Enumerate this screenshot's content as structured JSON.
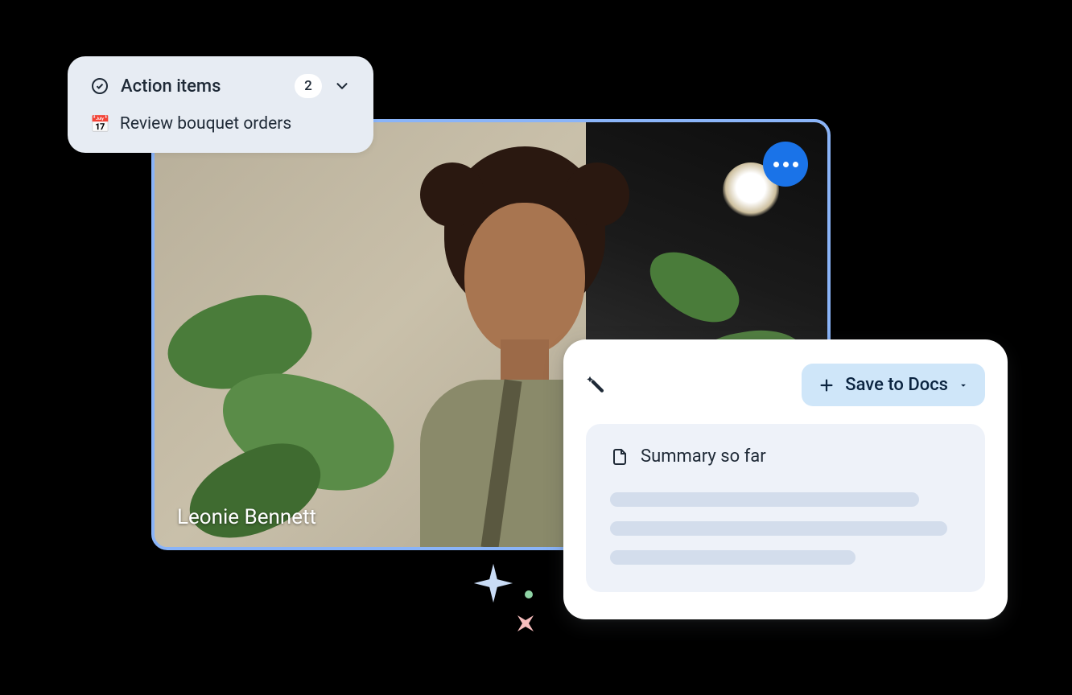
{
  "video": {
    "participant_name": "Leonie Bennett"
  },
  "action_items": {
    "title": "Action items",
    "count": "2",
    "items": [
      {
        "icon": "📅",
        "text": "Review bouquet orders"
      }
    ]
  },
  "summary": {
    "save_label": "Save to Docs",
    "heading": "Summary so far"
  }
}
